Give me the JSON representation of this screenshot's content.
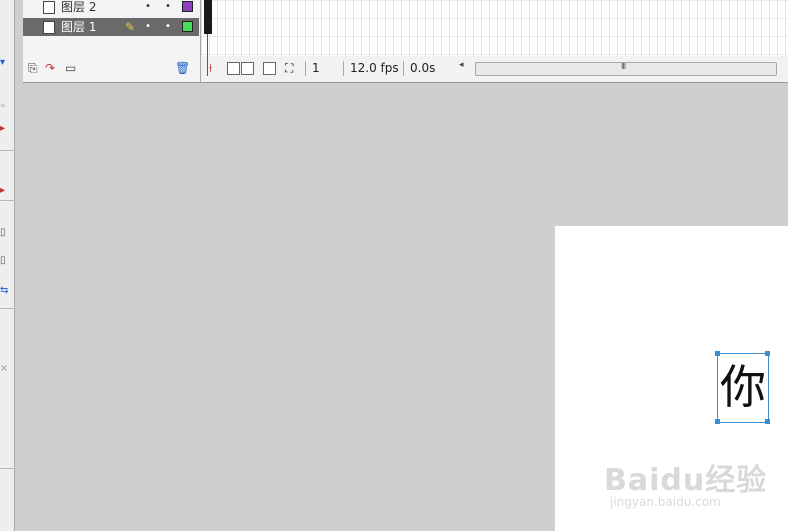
{
  "timeline": {
    "layers": [
      {
        "name": "图层 2",
        "color": "#8e3fbf",
        "selected": false
      },
      {
        "name": "图层 1",
        "color": "#44dd55",
        "selected": true
      }
    ],
    "controls": {
      "frame": "1",
      "fps": "12.0 fps",
      "time": "0.0s",
      "scroll_grip": "III"
    }
  },
  "stage": {
    "text_content": "你",
    "selection_color": "#3a8fd3"
  },
  "watermark": {
    "logo_text": "Baidu经验",
    "url_text": "jingyan.baidu.com"
  },
  "icons": [
    "layer-page-icon",
    "pencil-icon",
    "add-layer-icon",
    "add-guide-icon",
    "add-folder-icon",
    "trash-icon",
    "onion-skin-icon",
    "scroll-left-icon"
  ]
}
